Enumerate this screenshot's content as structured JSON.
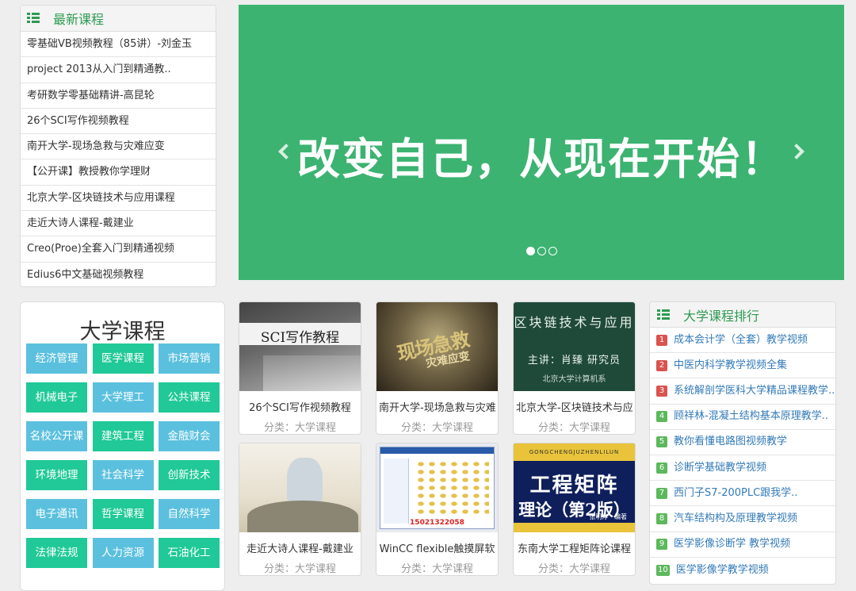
{
  "latest": {
    "title": "最新课程",
    "icon": "list-icon",
    "items": [
      "零基础VB视频教程（85讲）-刘金玉",
      "project 2013从入门到精通教..",
      "考研数学零基础精讲-高昆轮",
      "26个SCI写作视频教程",
      "南开大学-现场急救与灾难应变",
      "【公开课】教授教你学理财",
      "北京大学-区块链技术与应用课程",
      "走近大诗人课程-戴建业",
      "Creo(Proe)全套入门到精通视频",
      "Edius6中文基础视频教程"
    ]
  },
  "banner": {
    "text": "改变自己，从现在开始！",
    "prev_icon": "chevron-left-icon",
    "next_icon": "chevron-right-icon",
    "slides": 3,
    "active_slide": 1
  },
  "university": {
    "title": "大学课程",
    "categories": [
      "经济管理",
      "医学课程",
      "市场营销",
      "机械电子",
      "大学理工",
      "公共课程",
      "名校公开课",
      "建筑工程",
      "金融财会",
      "环境地理",
      "社会科学",
      "创新技术",
      "电子通讯",
      "哲学课程",
      "自然科学",
      "法律法规",
      "人力资源",
      "石油化工"
    ]
  },
  "courses": [
    {
      "title": "26个SCI写作视频教程",
      "category": "分类：大学课程",
      "thumb_text": "SCI写作教程"
    },
    {
      "title": "南开大学-现场急救与灾难",
      "category": "分类：大学课程",
      "thumb_text": "现场急救",
      "thumb_text2": "灾难应变"
    },
    {
      "title": "北京大学-区块链技术与应",
      "category": "分类：大学课程",
      "thumb_text": "区块链技术与应用",
      "thumb_text2": "主讲：肖臻 研究员",
      "thumb_text3": "北京大学计算机系"
    },
    {
      "title": "走近大诗人课程-戴建业",
      "category": "分类：大学课程"
    },
    {
      "title": "WinCC flexible触摸屏软",
      "category": "分类：大学课程",
      "thumb_text": "15021322058"
    },
    {
      "title": "东南大学工程矩阵论课程",
      "category": "分类：大学课程",
      "thumb_text": "GONGCHENGJUZHENLILUN",
      "thumb_text2": "工程矩阵",
      "thumb_text3": "理论（第2版）",
      "thumb_text4": "张明淳 · 编著"
    }
  ],
  "ranking": {
    "title": "大学课程排行",
    "icon": "list-icon",
    "items": [
      {
        "rank": "1",
        "title": "成本会计学（全套）教学视频",
        "color": "#d9534f"
      },
      {
        "rank": "2",
        "title": "中医内科学教学视频全集",
        "color": "#d9534f"
      },
      {
        "rank": "3",
        "title": "系统解剖学医科大学精品课程教学..",
        "color": "#d9534f"
      },
      {
        "rank": "4",
        "title": "顾祥林-混凝土结构基本原理教学..",
        "color": "#5cb85c"
      },
      {
        "rank": "5",
        "title": "教你看懂电路图视频教学",
        "color": "#5cb85c"
      },
      {
        "rank": "6",
        "title": "诊断学基础教学视频",
        "color": "#5cb85c"
      },
      {
        "rank": "7",
        "title": "西门子S7-200PLC跟我学..",
        "color": "#5cb85c"
      },
      {
        "rank": "8",
        "title": "汽车结构构及原理教学视频",
        "color": "#5cb85c"
      },
      {
        "rank": "9",
        "title": "医学影像诊断学 教学视频",
        "color": "#5cb85c"
      },
      {
        "rank": "10",
        "title": "医学影像学教学视频",
        "color": "#5cb85c"
      }
    ]
  }
}
